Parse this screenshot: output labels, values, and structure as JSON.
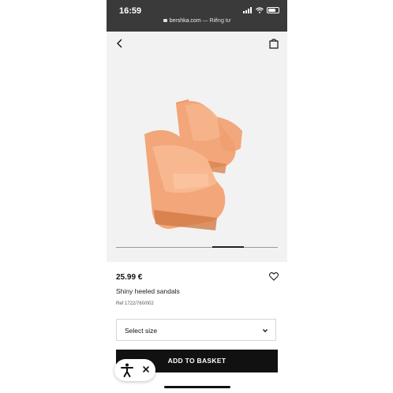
{
  "status_bar": {
    "time": "16:59",
    "icons": [
      "signal-icon",
      "wifi-icon",
      "battery-icon"
    ]
  },
  "browser": {
    "host": "bershka.com",
    "suffix": " — Riêng tư",
    "lock_icon": "lock-icon"
  },
  "nav": {
    "back_icon": "chevron-left-icon",
    "bag_icon": "shopping-bag-icon"
  },
  "gallery": {
    "image": "product-photo",
    "colors": {
      "sandal": "#f2a679",
      "background": "#f3f2f2"
    },
    "position": 0.67
  },
  "product": {
    "price": "25.99 €",
    "name": "Shiny heeled sandals",
    "ref": "Ref 1722/760/002",
    "wishlist_icon": "heart-icon"
  },
  "size_select": {
    "label": "Select size",
    "icon": "chevron-down-icon"
  },
  "cta": {
    "label": "ADD TO BASKET",
    "color": "#111111"
  },
  "accessibility_widget": {
    "icon": "accessibility-person-icon",
    "close_icon": "close-icon"
  }
}
